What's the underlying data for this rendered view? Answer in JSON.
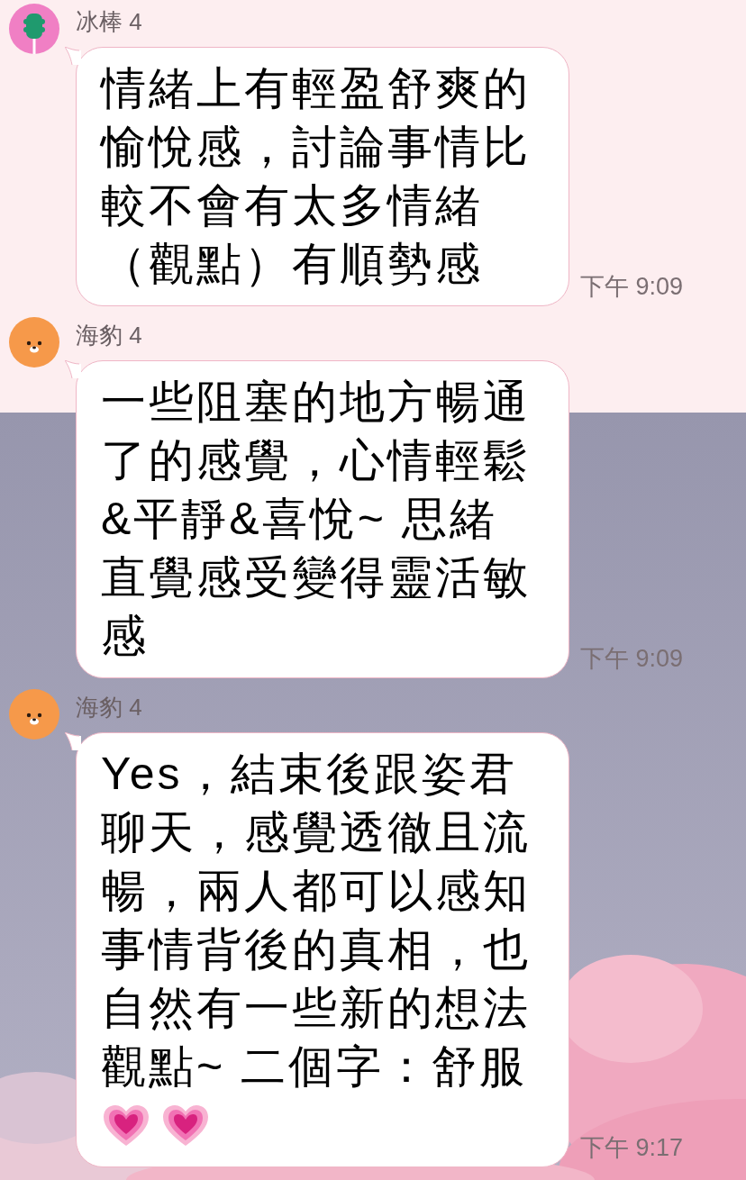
{
  "messages": [
    {
      "sender": "冰棒 4",
      "avatar": {
        "kind": "popsicle"
      },
      "text": "情緒上有輕盈舒爽的愉悅感，討論事情比較不會有太多情緒（觀點）有順勢感",
      "time": "下午 9:09"
    },
    {
      "sender": "海豹 4",
      "avatar": {
        "kind": "face"
      },
      "text": "一些阻塞的地方暢通了的感覺，心情輕鬆&平靜&喜悅~ 思緒直覺感受變得靈活敏感",
      "time": "下午 9:09"
    },
    {
      "sender": "海豹 4",
      "avatar": {
        "kind": "face"
      },
      "text": "Yes，結束後跟姿君聊天，感覺透徹且流暢，兩人都可以感知事情背後的真相，也自然有一些新的想法觀點~ 二個字：舒服",
      "emoji": [
        {
          "kind": "heart"
        },
        {
          "kind": "heart"
        }
      ],
      "time": "下午 9:17"
    }
  ]
}
